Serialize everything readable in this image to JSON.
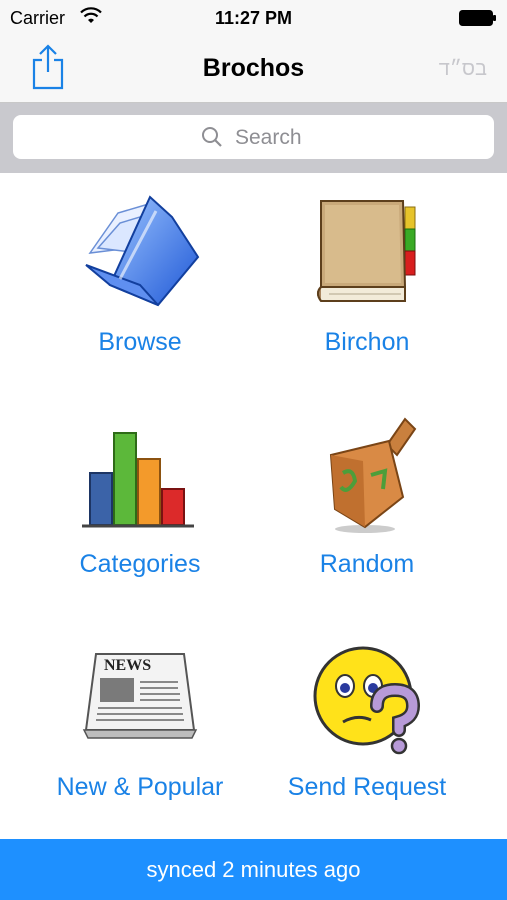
{
  "status_bar": {
    "carrier": "Carrier",
    "time": "11:27 PM"
  },
  "nav": {
    "title": "Brochos",
    "right_label": "בס״ד",
    "share_icon": "share-icon"
  },
  "search": {
    "placeholder": "Search"
  },
  "menu": [
    {
      "label": "Browse",
      "icon": "folder-icon"
    },
    {
      "label": "Birchon",
      "icon": "book-icon"
    },
    {
      "label": "Categories",
      "icon": "bar-chart-icon"
    },
    {
      "label": "Random",
      "icon": "dreidel-icon"
    },
    {
      "label": "New & Popular",
      "icon": "newspaper-icon"
    },
    {
      "label": "Send Request",
      "icon": "question-face-icon"
    }
  ],
  "sync": {
    "text": "synced 2 minutes ago"
  },
  "colors": {
    "accent": "#1a82e6",
    "sync_bar": "#1e90ff"
  }
}
